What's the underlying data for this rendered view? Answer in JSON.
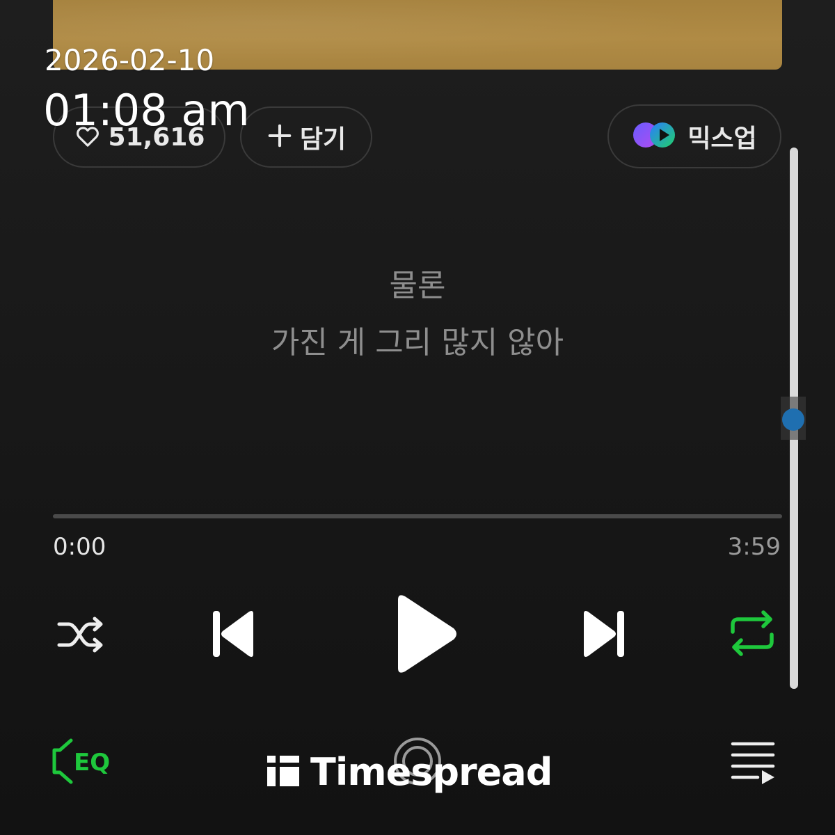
{
  "overlay": {
    "date": "2026-02-10",
    "time": "01:08 am"
  },
  "actions": {
    "like_count": "51,616",
    "add_label": "담기",
    "mixup_label": "믹스업"
  },
  "lyrics": {
    "line_1": "물론",
    "line_2": "가진 게 그리 많지 않아"
  },
  "player": {
    "current_time": "0:00",
    "total_time": "3:59",
    "progress": 0
  },
  "watermark": {
    "text": "Timespread"
  },
  "colors": {
    "background": "#141414",
    "accent_green": "#1ec83c",
    "scroll_thumb": "#1f6fb0",
    "album_art": "#a88440"
  },
  "icons": {
    "like": "heart-icon",
    "add": "plus-icon",
    "mixup": "mixup-icon",
    "shuffle": "shuffle-icon",
    "previous": "skip-previous-icon",
    "play": "play-icon",
    "next": "skip-next-icon",
    "repeat": "repeat-icon",
    "equalizer": "eq-icon",
    "center": "lyrics-mode-icon",
    "queue": "playlist-icon",
    "watermark_logo": "timespread-logo-icon"
  }
}
